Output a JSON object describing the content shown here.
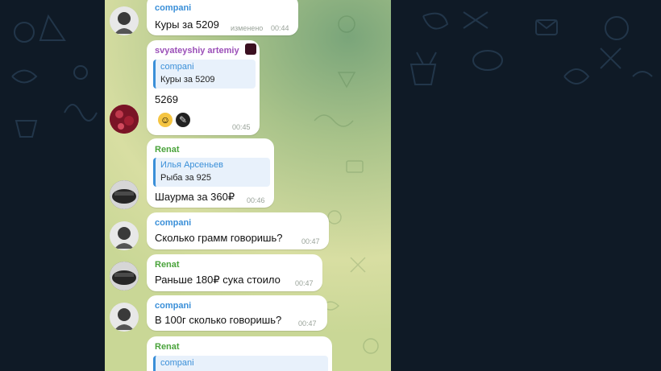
{
  "messages": [
    {
      "sender": "compani",
      "text": "Куры за 5209",
      "time": "00:44",
      "edited_label": "изменено"
    },
    {
      "sender": "svyateyshiy artemiy",
      "reply": {
        "sender": "compani",
        "text": "Куры за 5209"
      },
      "text": "5269",
      "time": "00:45",
      "reactions": [
        "grinning-face",
        "dark-emoji"
      ]
    },
    {
      "sender": "Renat",
      "reply": {
        "sender": "Илья Арсеньев",
        "text": "Рыба за 925"
      },
      "text": "Шаурма за 360₽",
      "time": "00:46"
    },
    {
      "sender": "compani",
      "text": "Сколько грамм говоришь?",
      "time": "00:47"
    },
    {
      "sender": "Renat",
      "text": "Раньше 180₽ сука стоило",
      "time": "00:47"
    },
    {
      "sender": "compani",
      "text": "В 100г сколько говоришь?",
      "time": "00:47"
    },
    {
      "sender": "Renat",
      "reply": {
        "sender": "compani",
        "text": ""
      }
    }
  ],
  "colors": {
    "compani": "#3a8fd8",
    "artemiy": "#9b4fb8",
    "renat": "#4aa33b",
    "bubble": "#ffffff",
    "side_bg": "#0f1a26"
  }
}
